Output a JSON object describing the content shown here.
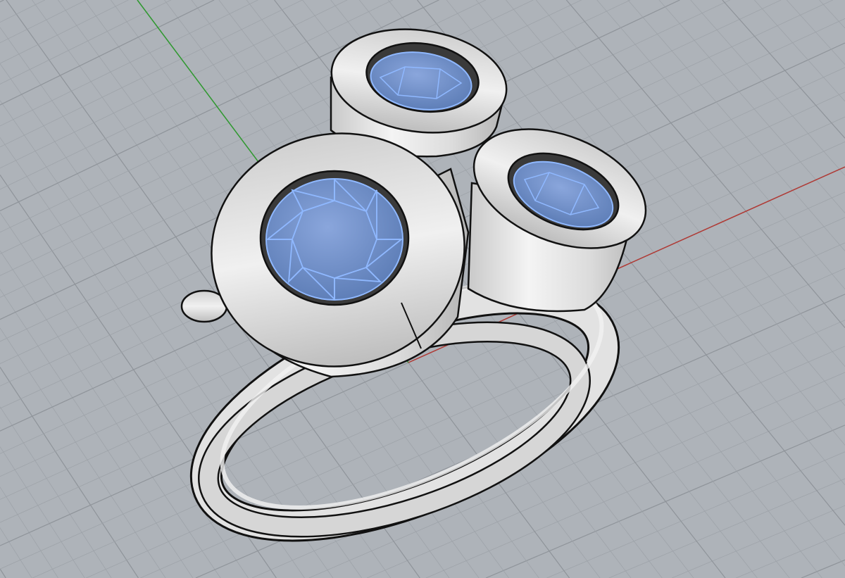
{
  "viewport": {
    "background_color": "#aeb3b9",
    "grid_minor_color": "#9ea3a9",
    "grid_major_color": "#8f949a",
    "x_axis_color": "#b03a35",
    "y_axis_color": "#2f9a2f",
    "metal_color": "#e6e6e6",
    "gem_color": "#7d9bd2",
    "gem_edge_color": "#8fb8ff",
    "outline_color": "#111111"
  }
}
